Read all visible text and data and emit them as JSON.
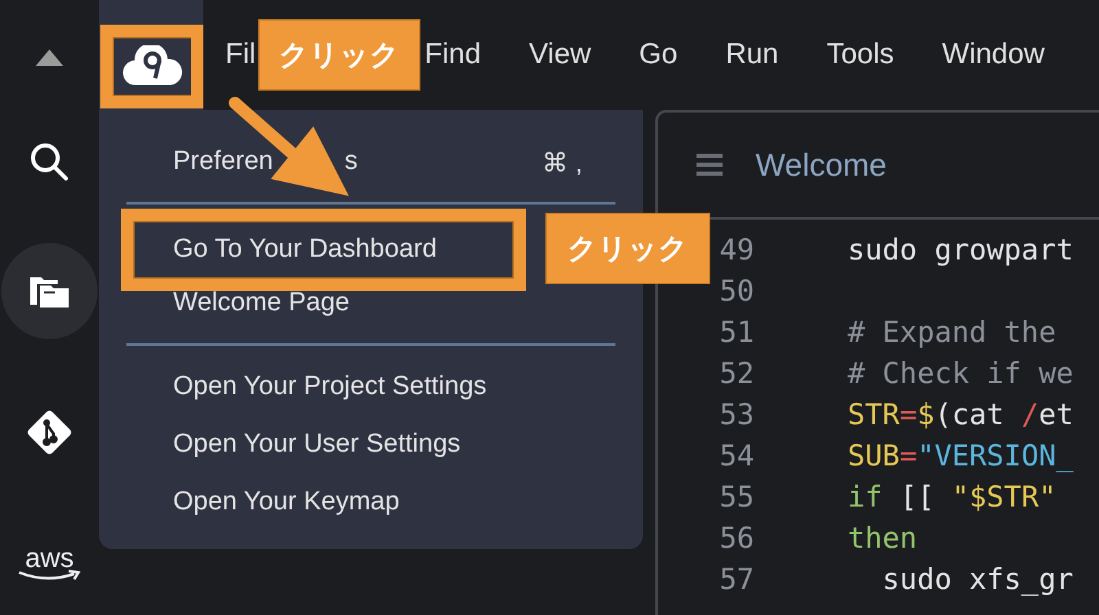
{
  "activity_bar": {
    "items": [
      {
        "kind": "collapse",
        "selected": false
      },
      {
        "kind": "search",
        "selected": false
      },
      {
        "kind": "explorer",
        "selected": true
      },
      {
        "kind": "git",
        "selected": false
      },
      {
        "kind": "aws",
        "label": "aws",
        "selected": false
      }
    ]
  },
  "logo": {
    "highlighted": true
  },
  "menu_bar": {
    "items": [
      "Fil",
      "Find",
      "View",
      "Go",
      "Run",
      "Tools",
      "Window"
    ]
  },
  "callouts": [
    "クリック",
    "クリック"
  ],
  "dropdown": {
    "items": [
      {
        "kind": "item",
        "label": "Preferen",
        "label_tail": "s",
        "shortcut": "⌘ ,",
        "highlighted": false
      },
      {
        "kind": "divider"
      },
      {
        "kind": "item",
        "label": "Go To Your Dashboard",
        "highlighted": true
      },
      {
        "kind": "item",
        "label": "Welcome Page",
        "highlighted": false
      },
      {
        "kind": "divider"
      },
      {
        "kind": "item",
        "label": "Open Your Project Settings",
        "highlighted": false
      },
      {
        "kind": "item",
        "label": "Open Your User Settings",
        "highlighted": false
      },
      {
        "kind": "item",
        "label": "Open Your Keymap",
        "highlighted": false
      }
    ]
  },
  "editor": {
    "tab": "Welcome",
    "lines": [
      {
        "number": "49",
        "tokens": [
          {
            "kind": "plain",
            "text": "sudo growpart"
          }
        ]
      },
      {
        "number": "50"
      },
      {
        "number": "51",
        "tokens": [
          {
            "kind": "comment",
            "text": "# Expand the"
          }
        ]
      },
      {
        "number": "52",
        "tokens": [
          {
            "kind": "comment",
            "text": "# Check if we"
          }
        ]
      },
      {
        "number": "53",
        "tokens": [
          {
            "kind": "variable",
            "text": "STR"
          },
          {
            "kind": "operator",
            "text": "="
          },
          {
            "kind": "variable",
            "text": "$"
          },
          {
            "kind": "plain",
            "text": "(cat "
          },
          {
            "kind": "operator",
            "text": "/"
          },
          {
            "kind": "plain",
            "text": "et"
          }
        ]
      },
      {
        "number": "54",
        "tokens": [
          {
            "kind": "variable",
            "text": "SUB"
          },
          {
            "kind": "operator",
            "text": "="
          },
          {
            "kind": "string",
            "text": "\"VERSION_"
          }
        ]
      },
      {
        "number": "55",
        "tokens": [
          {
            "kind": "keyword",
            "text": "if"
          },
          {
            "kind": "plain",
            "text": " [[ "
          },
          {
            "kind": "variable",
            "text": "\"$STR\""
          }
        ]
      },
      {
        "number": "56",
        "tokens": [
          {
            "kind": "keyword",
            "text": "then"
          }
        ]
      },
      {
        "number": "57",
        "tokens": [
          {
            "kind": "plain",
            "text": "  sudo xfs_gr"
          }
        ]
      }
    ]
  }
}
